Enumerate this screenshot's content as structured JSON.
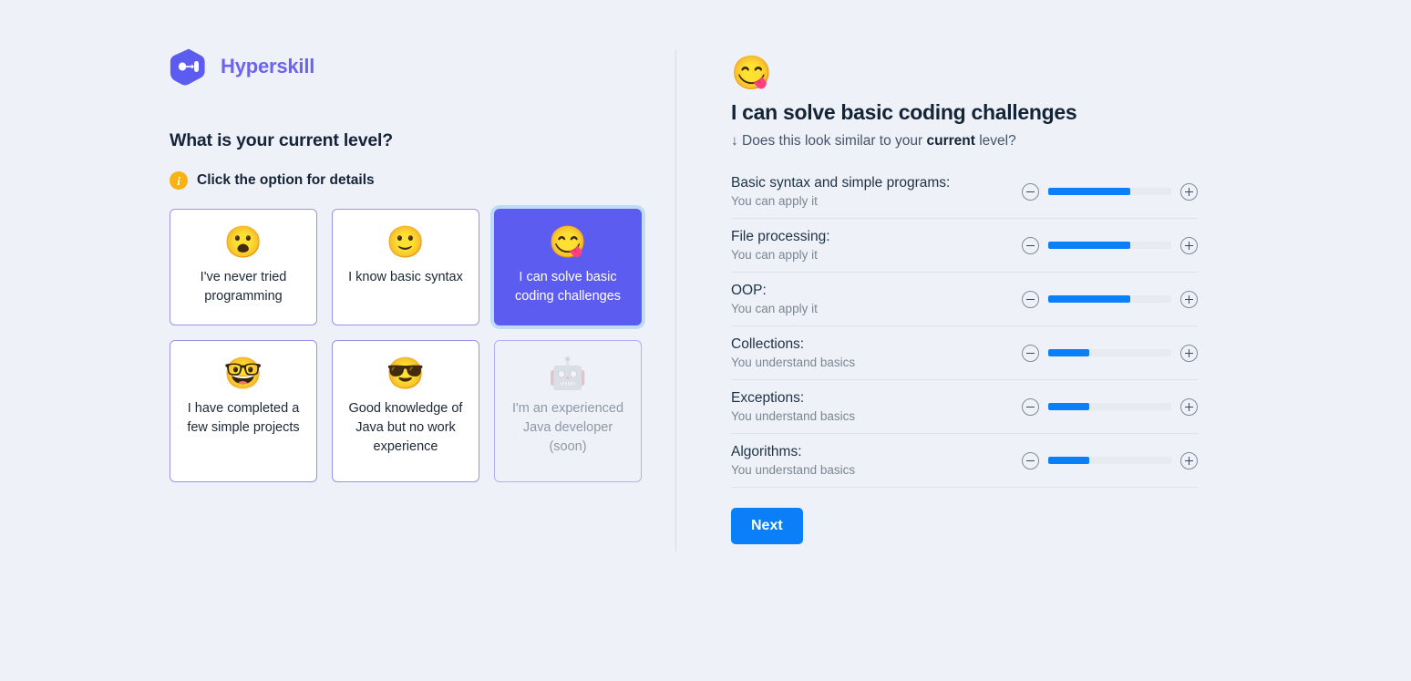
{
  "brand": {
    "name": "Hyperskill",
    "logo_icon": "hyperskill-logo-icon",
    "logo_color": "#6c63f0"
  },
  "left": {
    "question_title": "What is your current level?",
    "hint": {
      "icon": "info-icon",
      "icon_glyph": "i",
      "text": "Click the option for details",
      "icon_color": "#f8b313"
    },
    "options": [
      {
        "emoji": "😮",
        "emoji_name": "face-with-open-mouth-emoji",
        "label": "I've never tried programming",
        "state": "default"
      },
      {
        "emoji": "🙂",
        "emoji_name": "slightly-smiling-face-emoji",
        "label": "I know basic syntax",
        "state": "default"
      },
      {
        "emoji": "😋",
        "emoji_name": "face-savoring-food-emoji",
        "label": "I can solve basic coding challenges",
        "state": "selected"
      },
      {
        "emoji": "🤓",
        "emoji_name": "nerd-face-emoji",
        "label": "I have completed a few simple projects",
        "state": "default"
      },
      {
        "emoji": "😎",
        "emoji_name": "smiling-face-with-sunglasses-emoji",
        "label": "Good knowledge of Java but no work experience",
        "state": "default"
      },
      {
        "emoji": "🤖",
        "emoji_name": "robot-emoji",
        "label": "I'm an experienced Java developer (soon)",
        "state": "disabled"
      }
    ]
  },
  "right": {
    "emoji": "😋",
    "emoji_name": "face-savoring-food-emoji",
    "title": "I can solve basic coding challenges",
    "subtitle_prefix": "↓ Does this look similar to your ",
    "subtitle_strong": "current",
    "subtitle_suffix": " level?",
    "skills": [
      {
        "name": "Basic syntax and simple programs:",
        "level": "You can apply it",
        "value": 67
      },
      {
        "name": "File processing:",
        "level": "You can apply it",
        "value": 67
      },
      {
        "name": "OOP:",
        "level": "You can apply it",
        "value": 67
      },
      {
        "name": "Collections:",
        "level": "You understand basics",
        "value": 33
      },
      {
        "name": "Exceptions:",
        "level": "You understand basics",
        "value": 33
      },
      {
        "name": "Algorithms:",
        "level": "You understand basics",
        "value": 33
      }
    ],
    "decrease_label": "−",
    "increase_label": "+",
    "next_label": "Next",
    "accent_color": "#0b7ff7"
  }
}
